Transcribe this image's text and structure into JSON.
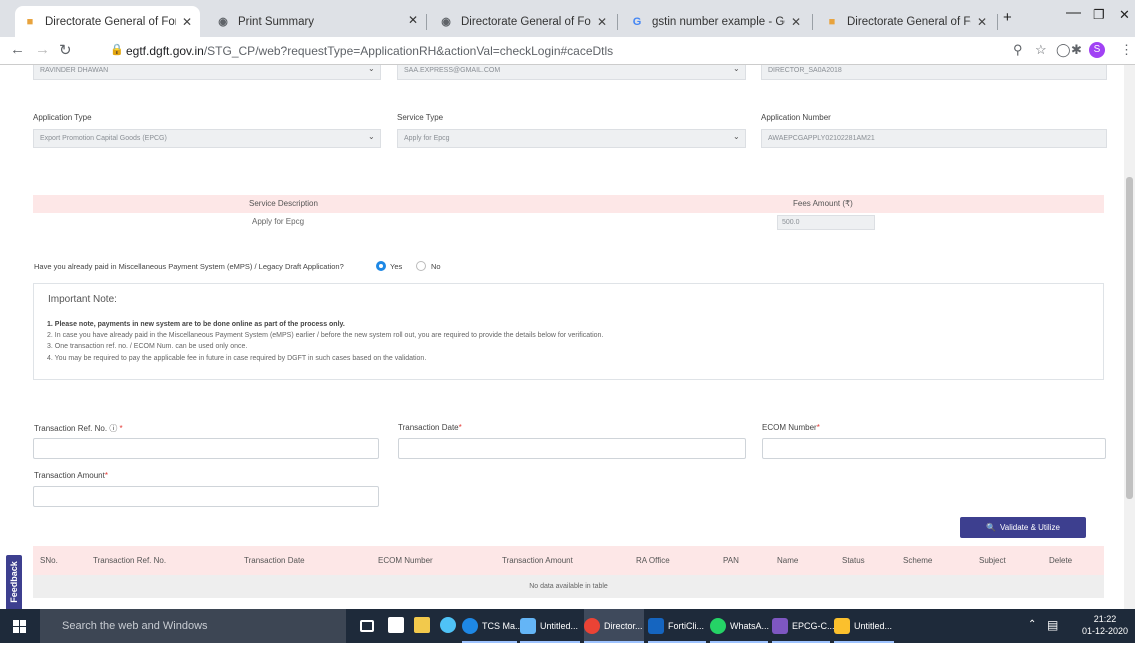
{
  "browser": {
    "tabs": [
      {
        "title": "Directorate General of Foreign",
        "active": true
      },
      {
        "title": "Print Summary"
      },
      {
        "title": "Directorate General of Foreign"
      },
      {
        "title": "gstin number example - Googl"
      },
      {
        "title": "Directorate General of Foreign"
      }
    ],
    "new_tab": "+",
    "url_domain": "egtf.dgft.gov.in",
    "url_path": "/STG_CP/web?requestType=ApplicationRH&actionVal=checkLogin#caceDtls",
    "profile_initial": "S"
  },
  "form": {
    "top_values": [
      "RAVINDER DHAWAN",
      "SAA.EXPRESS@GMAIL.COM",
      "DIRECTOR_SA0A2018"
    ],
    "application_type_label": "Application Type",
    "application_type_value": "Export Promotion Capital Goods (EPCG)",
    "service_type_label": "Service Type",
    "service_type_value": "Apply for Epcg",
    "application_number_label": "Application Number",
    "application_number_value": "AWAEPCGAPPLY02102281AM21",
    "service_description_header": "Service Description",
    "fees_header": "Fees Amount (₹)",
    "service_description": "Apply for Epcg",
    "fees_amount": "500.0",
    "emps_question": "Have you already paid in Miscellaneous Payment System (eMPS) / Legacy Draft Application?",
    "radio_yes": "Yes",
    "radio_no": "No",
    "note_title": "Important Note:",
    "notes": [
      "1. Please note, payments in new system are to be done online as part of the process only.",
      "2. In case you have already paid in the Miscellaneous Payment System (eMPS) earlier / before the new system roll out, you are required to provide the details below for verification.",
      "3. One transaction ref. no. / ECOM Num. can be used only once.",
      "4. You may be required to pay the applicable fee in future in case required by DGFT in such cases based on the validation."
    ],
    "transaction_ref_label": "Transaction Ref. No.",
    "transaction_date_label": "Transaction Date",
    "ecom_number_label": "ECOM Number",
    "transaction_amount_label": "Transaction Amount",
    "required_mark": "*",
    "validate_button": "Validate & Utilize",
    "table_headers": [
      "SNo.",
      "Transaction Ref. No.",
      "Transaction Date",
      "ECOM Number",
      "Transaction Amount",
      "RA Office",
      "PAN",
      "Name",
      "Status",
      "Scheme",
      "Subject",
      "Delete"
    ],
    "empty_message": "No data available in table",
    "feedback_tab": "Feedback"
  },
  "taskbar": {
    "search_placeholder": "Search the web and Windows",
    "apps": [
      "TCS Ma...",
      "Untitled...",
      "Director...",
      "FortiCli...",
      "WhatsA...",
      "EPCG-C...",
      "Untitled..."
    ],
    "time": "21:22",
    "date": "01-12-2020"
  },
  "colors": {
    "accent": "#3d3f8f",
    "band": "#fde7e7",
    "tabbar": "#dee1e6",
    "taskbar": "#1e2a3a",
    "radio_selected": "#1e88e5"
  }
}
